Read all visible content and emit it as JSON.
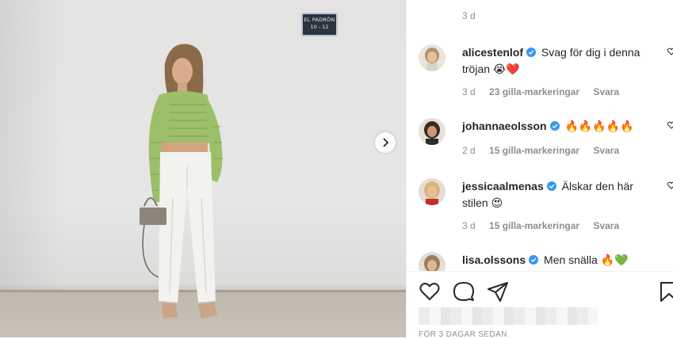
{
  "post": {
    "sign": {
      "name": "EL PADRÓN",
      "number": "10 - 12"
    },
    "time_ago_top": "3 d",
    "posted_label": "FÖR 3 DAGAR SEDAN"
  },
  "comments": [
    {
      "username": "alicestenlof",
      "text_line1": "Svag för dig i denna",
      "text_line2": "tröjan 😭❤️",
      "time": "3 d",
      "likes": "23 gilla-markeringar",
      "reply": "Svara"
    },
    {
      "username": "johannaeolsson",
      "text_line1": "🔥🔥🔥🔥🔥",
      "text_line2": "",
      "time": "2 d",
      "likes": "15 gilla-markeringar",
      "reply": "Svara"
    },
    {
      "username": "jessicaalmenas",
      "text_line1": "Älskar den här",
      "text_line2": "stilen 😍",
      "time": "3 d",
      "likes": "15 gilla-markeringar",
      "reply": "Svara"
    },
    {
      "username": "lisa.olssons",
      "text_line1": "Men snälla 🔥💚",
      "text_line2": "",
      "time": "",
      "likes": "",
      "reply": ""
    }
  ],
  "colors": {
    "verified": "#3897f0",
    "text": "#262626",
    "secondary": "#8e8e8e"
  },
  "icons": [
    "heart-icon",
    "comment-icon",
    "share-icon",
    "bookmark-icon",
    "chevron-right-icon",
    "verified-icon"
  ]
}
